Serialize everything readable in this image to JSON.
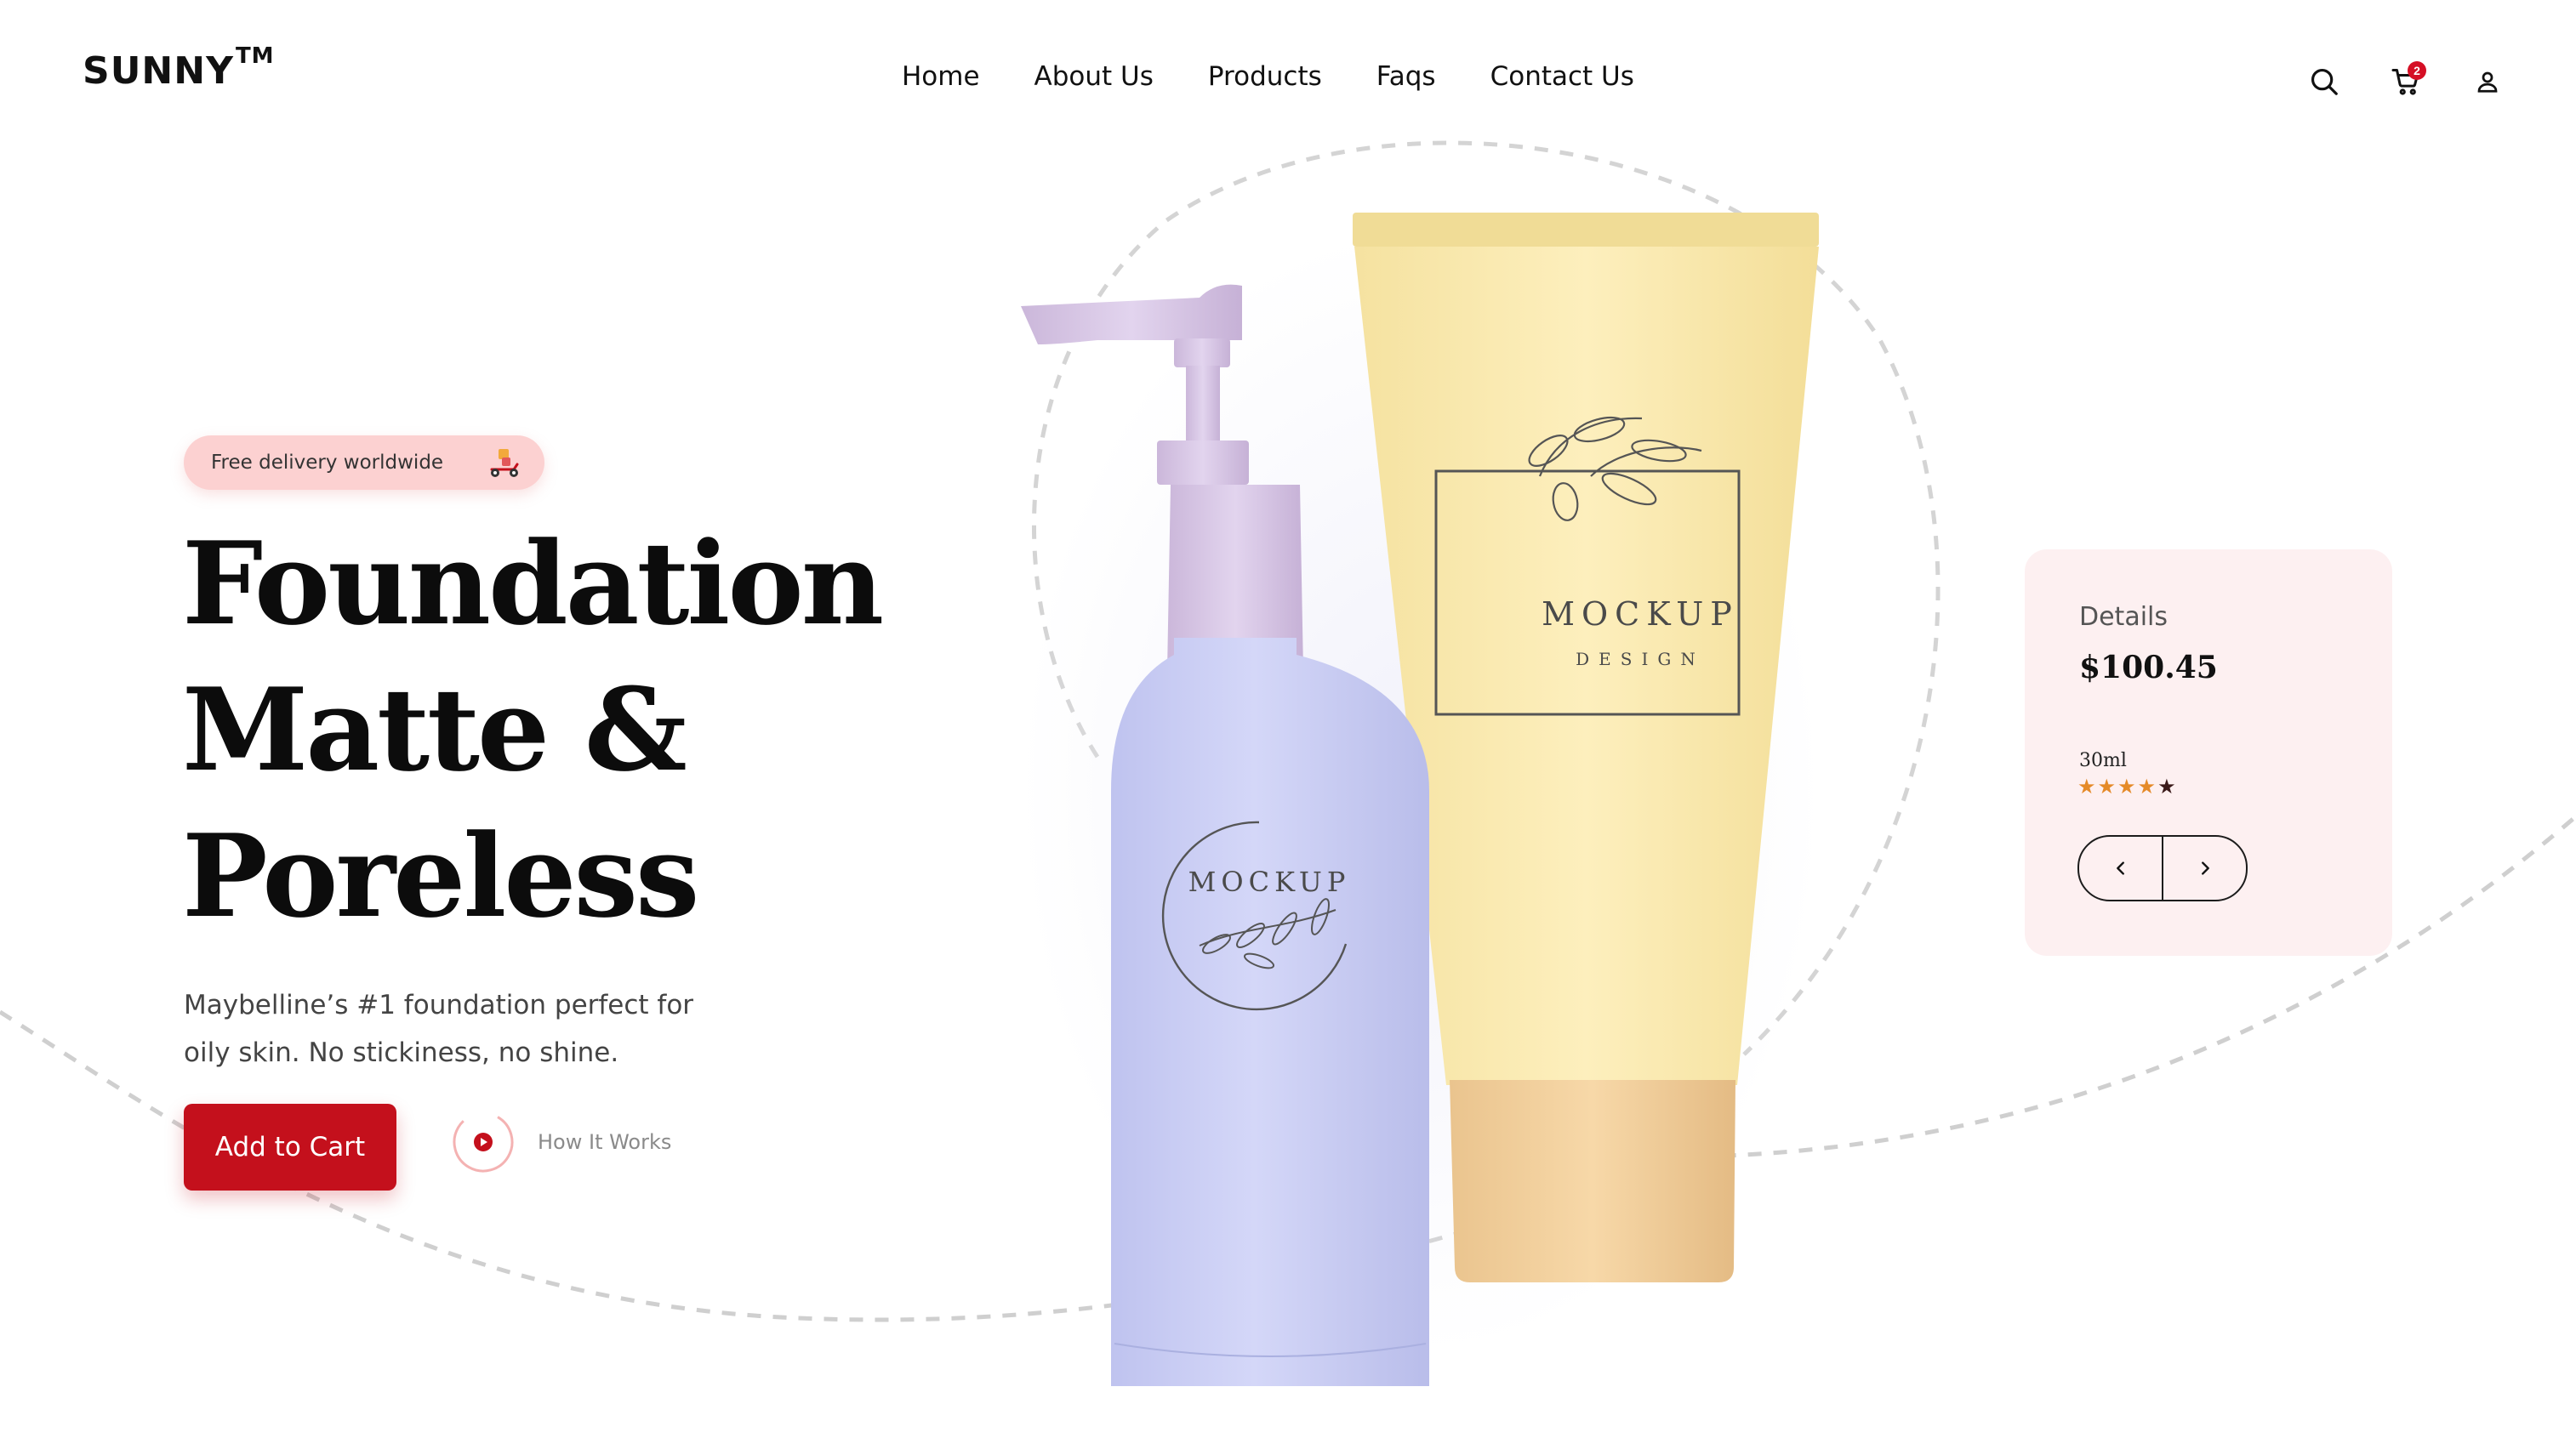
{
  "brand": {
    "name": "SUNNY",
    "mark": "TM"
  },
  "nav": {
    "items": [
      {
        "label": "Home"
      },
      {
        "label": "About Us"
      },
      {
        "label": "Products"
      },
      {
        "label": "Faqs"
      },
      {
        "label": "Contact Us"
      }
    ]
  },
  "header_icons": {
    "search": "search-icon",
    "cart": "cart-icon",
    "cart_count": "2",
    "user": "user-icon"
  },
  "hero": {
    "badge_text": "Free delivery worldwide",
    "badge_icon": "scooter-icon",
    "title_lines": [
      "Foundation",
      "Matte &",
      "Poreless"
    ],
    "description_lines": [
      "Maybelline’s #1 foundation perfect for",
      "oily skin. No stickiness, no shine."
    ],
    "cta_label": "Add to Cart",
    "secondary_label": "How It Works",
    "secondary_icon": "play-icon"
  },
  "products": {
    "bottle_label": "MOCKUP",
    "tube_label": "MOCKUP",
    "tube_sublabel": "DESIGN"
  },
  "details": {
    "label": "Details",
    "price": "$100.45",
    "size": "30ml",
    "rating": 4,
    "rating_max": 5,
    "prev_icon": "chevron-left-icon",
    "next_icon": "chevron-right-icon"
  },
  "colors": {
    "accent": "#c4101c",
    "badge_bg": "#fcd1d1",
    "card_bg": "#fdf0f1",
    "star_filled": "#e58a28",
    "star_empty": "#3b1a1a"
  }
}
